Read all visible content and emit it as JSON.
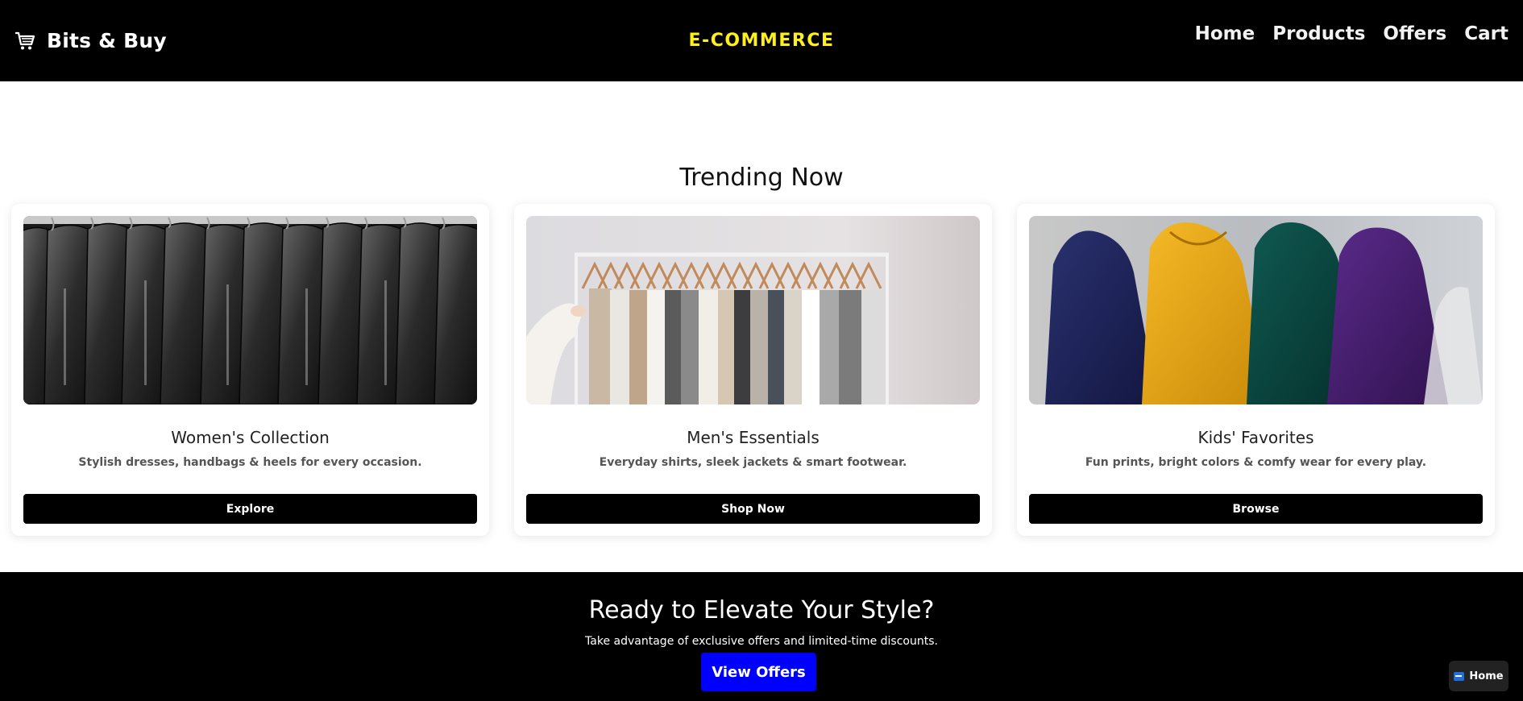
{
  "header": {
    "brand_icon": "shopping-cart-icon",
    "brand_name": "Bits & Buy",
    "center_title": "E-COMMERCE",
    "nav": [
      {
        "label": "Home"
      },
      {
        "label": "Products"
      },
      {
        "label": "Offers"
      },
      {
        "label": "Cart"
      }
    ]
  },
  "trending": {
    "title": "Trending Now",
    "cards": [
      {
        "title": "Women's Collection",
        "description": "Stylish dresses, handbags & heels for every occasion.",
        "button": "Explore",
        "image": "black-leather-jackets-on-rack"
      },
      {
        "title": "Men's Essentials",
        "description": "Everyday shirts, sleek jackets & smart footwear.",
        "button": "Shop Now",
        "image": "neutral-clothes-on-hanger-rail"
      },
      {
        "title": "Kids' Favorites",
        "description": "Fun prints, bright colors & comfy wear for every play.",
        "button": "Browse",
        "image": "colorful-hoodies-on-hangers"
      }
    ]
  },
  "cta": {
    "title": "Ready to Elevate Your Style?",
    "subtitle": "Take advantage of exclusive offers and limited-time discounts.",
    "button": "View Offers"
  },
  "floating_home": {
    "label": "Home",
    "icon": "back-arrow-icon"
  },
  "colors": {
    "header_bg": "#000000",
    "accent_yellow": "#ffef1a",
    "cta_button": "#0000ff",
    "card_button": "#000000"
  }
}
